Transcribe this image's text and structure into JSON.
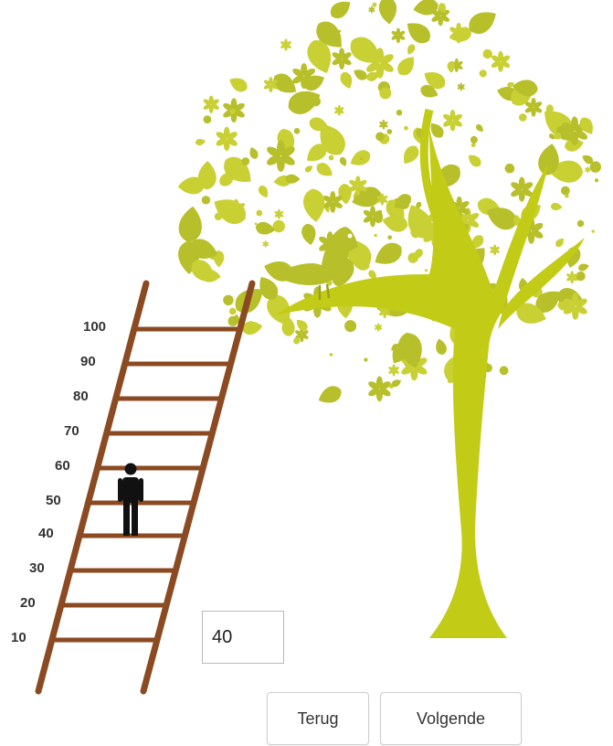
{
  "ladder": {
    "labels": [
      "100",
      "90",
      "80",
      "70",
      "60",
      "50",
      "40",
      "30",
      "20",
      "10"
    ],
    "person_level": 50
  },
  "answer": {
    "value": "40"
  },
  "buttons": {
    "back_label": "Terug",
    "next_label": "Volgende"
  },
  "colors": {
    "ladder_wood": "#8b4a22",
    "foliage": "#b7bf2a",
    "foliage_light": "#c9d034",
    "trunk": "#c2cc16",
    "person": "#111111"
  },
  "icons": {
    "person": "person-icon",
    "bird": "bird-icon",
    "tree": "tree-illustration"
  }
}
